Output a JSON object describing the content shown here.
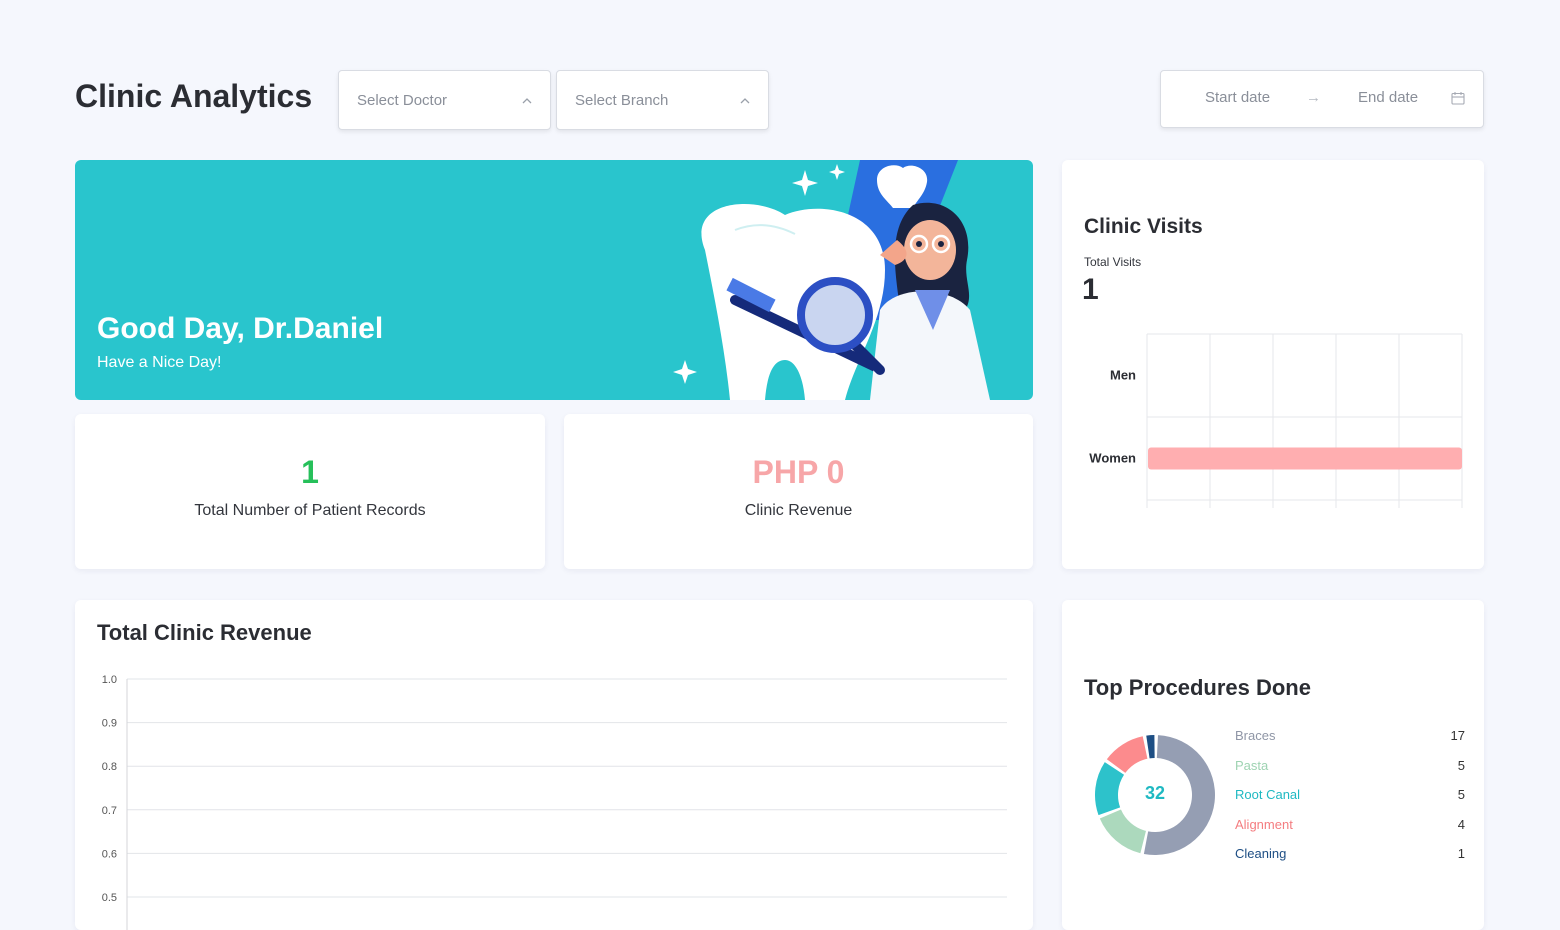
{
  "header": {
    "title": "Clinic Analytics",
    "doctor_placeholder": "Select Doctor",
    "branch_placeholder": "Select Branch",
    "start_date_placeholder": "Start date",
    "end_date_placeholder": "End date",
    "arrow": "→"
  },
  "banner": {
    "greeting": "Good Day, Dr.Daniel",
    "subtitle": "Have a Nice Day!"
  },
  "stats": {
    "patients_value": "1",
    "patients_label": "Total Number of Patient Records",
    "revenue_value": "PHP 0",
    "revenue_label": "Clinic Revenue"
  },
  "visits": {
    "title": "Clinic Visits",
    "total_label": "Total Visits",
    "total_value": "1",
    "chart_data": {
      "type": "bar",
      "orientation": "horizontal",
      "categories": [
        "Men",
        "Women"
      ],
      "values": [
        0,
        1
      ],
      "color": "#ffaeb0",
      "grid": true
    }
  },
  "revenue_chart": {
    "title": "Total Clinic Revenue",
    "chart_data": {
      "type": "line",
      "title": "Total Clinic Revenue",
      "yticks": [
        "1.0",
        "0.9",
        "0.8",
        "0.7",
        "0.6",
        "0.5"
      ],
      "ylim": [
        0.5,
        1.0
      ],
      "grid": true,
      "series": []
    }
  },
  "procedures": {
    "title": "Top Procedures Done",
    "total": "32",
    "chart_data": {
      "type": "pie",
      "categories": [
        "Braces",
        "Pasta",
        "Root Canal",
        "Alignment",
        "Cleaning"
      ],
      "values": [
        17,
        5,
        5,
        4,
        1
      ],
      "colors": [
        "#959eb3",
        "#acd9bd",
        "#2dc2cb",
        "#fc8b8d",
        "#1d4e84"
      ]
    },
    "legend": [
      {
        "name": "Braces",
        "value": "17",
        "color": "#8f96a6"
      },
      {
        "name": "Pasta",
        "value": "5",
        "color": "#9ed3b2"
      },
      {
        "name": "Root Canal",
        "value": "5",
        "color": "#1fb9c2"
      },
      {
        "name": "Alignment",
        "value": "4",
        "color": "#f47d80"
      },
      {
        "name": "Cleaning",
        "value": "1",
        "color": "#1d4e84"
      }
    ]
  }
}
